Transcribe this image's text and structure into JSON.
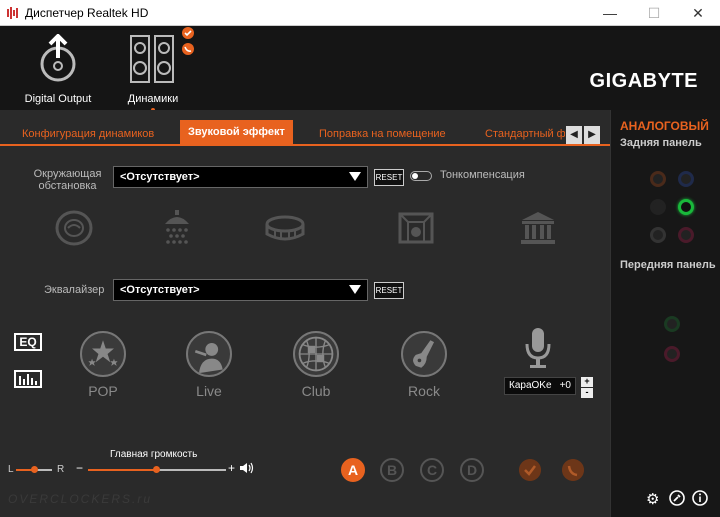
{
  "window": {
    "title": "Диспетчер Realtek HD",
    "min_glyph": "—",
    "max_glyph": "☐",
    "close_glyph": "✕"
  },
  "devices": [
    {
      "label": "Digital Output",
      "icon": "digital-output-icon"
    },
    {
      "label": "Динамики",
      "icon": "speakers-icon"
    }
  ],
  "brand": "GIGABYTE",
  "tabs": [
    {
      "label": "Конфигурация динамиков"
    },
    {
      "label": "Звуковой эффект",
      "active": true
    },
    {
      "label": "Поправка на помещение"
    },
    {
      "label": "Стандартный фо"
    }
  ],
  "environment": {
    "label": "Окружающая обстановка",
    "value": "<Отсутствует>",
    "reset": "RESET",
    "loudness_label": "Тонкомпенсация",
    "icons": [
      "sewer-pipe-icon",
      "shower-icon",
      "stadium-icon",
      "room-icon",
      "museum-icon"
    ]
  },
  "equalizer": {
    "label": "Эквалайзер",
    "value": "<Отсутствует>",
    "reset": "RESET",
    "eq_button": "EQ",
    "presets": [
      "POP",
      "Live",
      "Club",
      "Rock"
    ],
    "karaoke": {
      "label": "КараOKe",
      "value": "+0",
      "plus": "+",
      "minus": "-"
    }
  },
  "volume": {
    "label": "Главная громкость",
    "left": "L",
    "right": "R",
    "minus": "−",
    "plus": "+",
    "level": 0.5,
    "balance": 0.5
  },
  "profiles": [
    "A",
    "B",
    "C",
    "D"
  ],
  "right_panel": {
    "title": "АНАЛОГОВЫЙ",
    "back": "Задняя панель",
    "front": "Передняя панель"
  },
  "watermark": "OVERCLOCKERS.ru",
  "colors": {
    "accent": "#e8621f",
    "active_jack": "#19b83b"
  }
}
